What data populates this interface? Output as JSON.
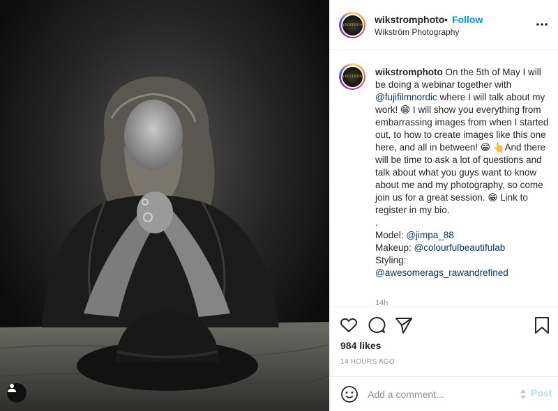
{
  "post": {
    "username": "wikstromphoto",
    "follow_label": "Follow",
    "dot": "•",
    "location": "Wikström Photography",
    "avatar_text": "WIKSTRÖM",
    "caption": {
      "username": "wikstromphoto",
      "segments": [
        {
          "text": " On the 5th of May I will be doing a webinar together with ",
          "type": "text"
        },
        {
          "text": "@fujifilmnordic",
          "type": "mention"
        },
        {
          "text": " where I will talk about my work! 😁 I will show you everything from embarrassing images from when I started out, to how to create images like this one here, and all in between! 😁 👆And there will be time to ask a lot of questions and talk about what you guys want to know about me and my photography, so come join us for a great session. 😁 Link to register in my bio.\n.\nModel: ",
          "type": "text"
        },
        {
          "text": "@jimpa_88",
          "type": "mention"
        },
        {
          "text": "\nMakeup: ",
          "type": "text"
        },
        {
          "text": "@colourfulbeautifulab",
          "type": "mention"
        },
        {
          "text": "\nStyling:\n",
          "type": "text"
        },
        {
          "text": "@awesomerags_rawandrefined",
          "type": "mention"
        }
      ]
    },
    "comment_time": "14h",
    "likes": "984 likes",
    "posted": "14 HOURS AGO",
    "comment_placeholder": "Add a comment...",
    "post_label": "Post"
  },
  "icons": {
    "like": "heart-icon",
    "comment": "comment-icon",
    "share": "paper-plane-icon",
    "save": "bookmark-icon",
    "more": "more-options-icon",
    "emoji": "emoji-icon",
    "user_tag": "user-icon"
  },
  "colors": {
    "follow": "#0095f6",
    "mention": "#00376b",
    "muted": "#8e8e8e",
    "post_disabled": "#b2dffc"
  }
}
